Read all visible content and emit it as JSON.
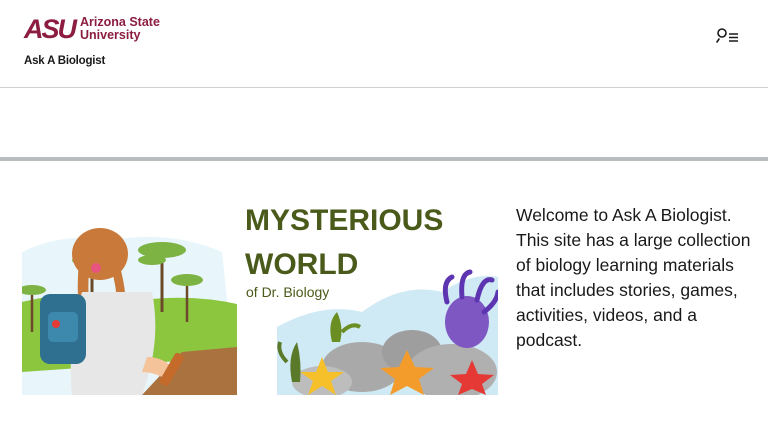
{
  "header": {
    "logo_mark": "ASU",
    "logo_line1": "Arizona State",
    "logo_line2": "University",
    "site_title": "Ask A Biologist",
    "menu_icon": "search-menu-icon"
  },
  "hero": {
    "title_line1": "MYSTERIOUS",
    "title_line2": "WORLD",
    "subtitle": "of Dr. Biology"
  },
  "intro": {
    "text": "Welcome to Ask A Biologist. This site has a large collection of biology learning materials that includes stories, games, activities, videos, and a podcast."
  },
  "colors": {
    "asu_maroon": "#8c1d40",
    "title_green": "#4a5a1a",
    "divider": "#b8bec0"
  }
}
